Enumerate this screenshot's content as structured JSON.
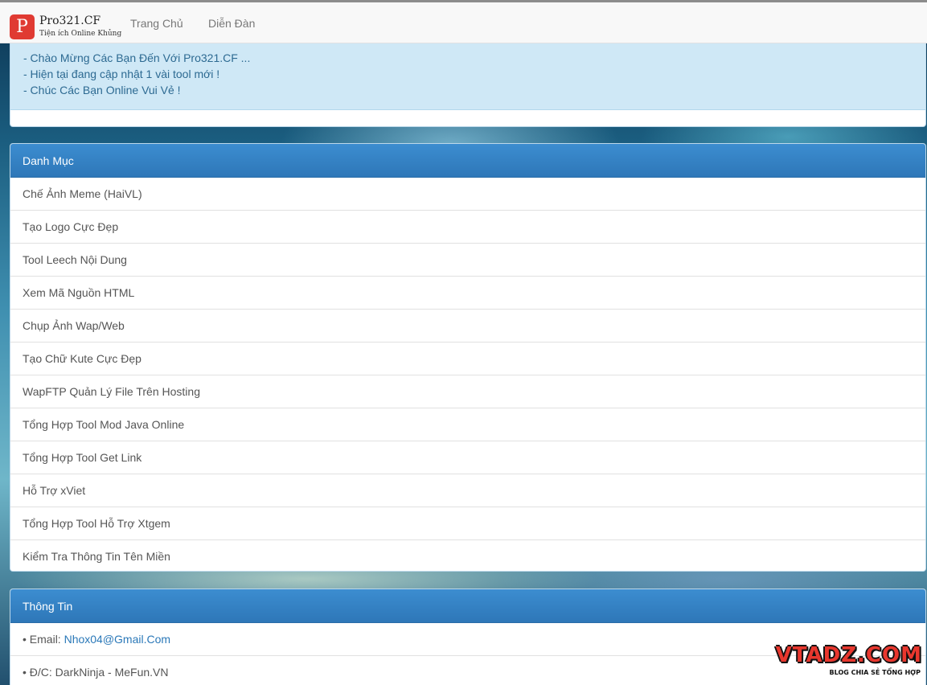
{
  "navbar": {
    "brand_letter": "P",
    "brand_name": "Pro321.CF",
    "brand_tagline": "Tiện ích Online Khủng",
    "links": [
      "Trang Chủ",
      "Diễn Đàn"
    ]
  },
  "notice": {
    "lines": [
      "- Chào Mừng Các Bạn Đến Với Pro321.CF ...",
      "- Hiện tại đang cập nhật 1 vài tool mới !",
      "- Chúc Các Bạn Online Vui Vẻ !"
    ]
  },
  "menu": {
    "title": "Danh Mục",
    "items": [
      "Chế Ảnh Meme (HaiVL)",
      "Tạo Logo Cực Đẹp",
      "Tool Leech Nội Dung",
      "Xem Mã Nguồn HTML",
      "Chụp Ảnh Wap/Web",
      "Tạo Chữ Kute Cực Đẹp",
      "WapFTP Quản Lý File Trên Hosting",
      "Tổng Hợp Tool Mod Java Online",
      "Tổng Hợp Tool Get Link",
      "Hỗ Trợ xViet",
      "Tổng Hợp Tool Hỗ Trợ Xtgem",
      "Kiểm Tra Thông Tin Tên Miền"
    ]
  },
  "info": {
    "title": "Thông Tin",
    "email_label": "• Email: ",
    "email": "Nhox04@Gmail.Com",
    "address": "• Đ/C: DarkNinja - MeFun.VN"
  },
  "watermark": {
    "text": "VTADZ.COM",
    "subtitle": "BLOG CHIA SẺ TỔNG HỢP"
  },
  "colors": {
    "panel_heading": "#337ab7",
    "alert_bg": "#cfe8f6",
    "brand_logo": "#e03a32",
    "watermark": "#e8372e"
  }
}
